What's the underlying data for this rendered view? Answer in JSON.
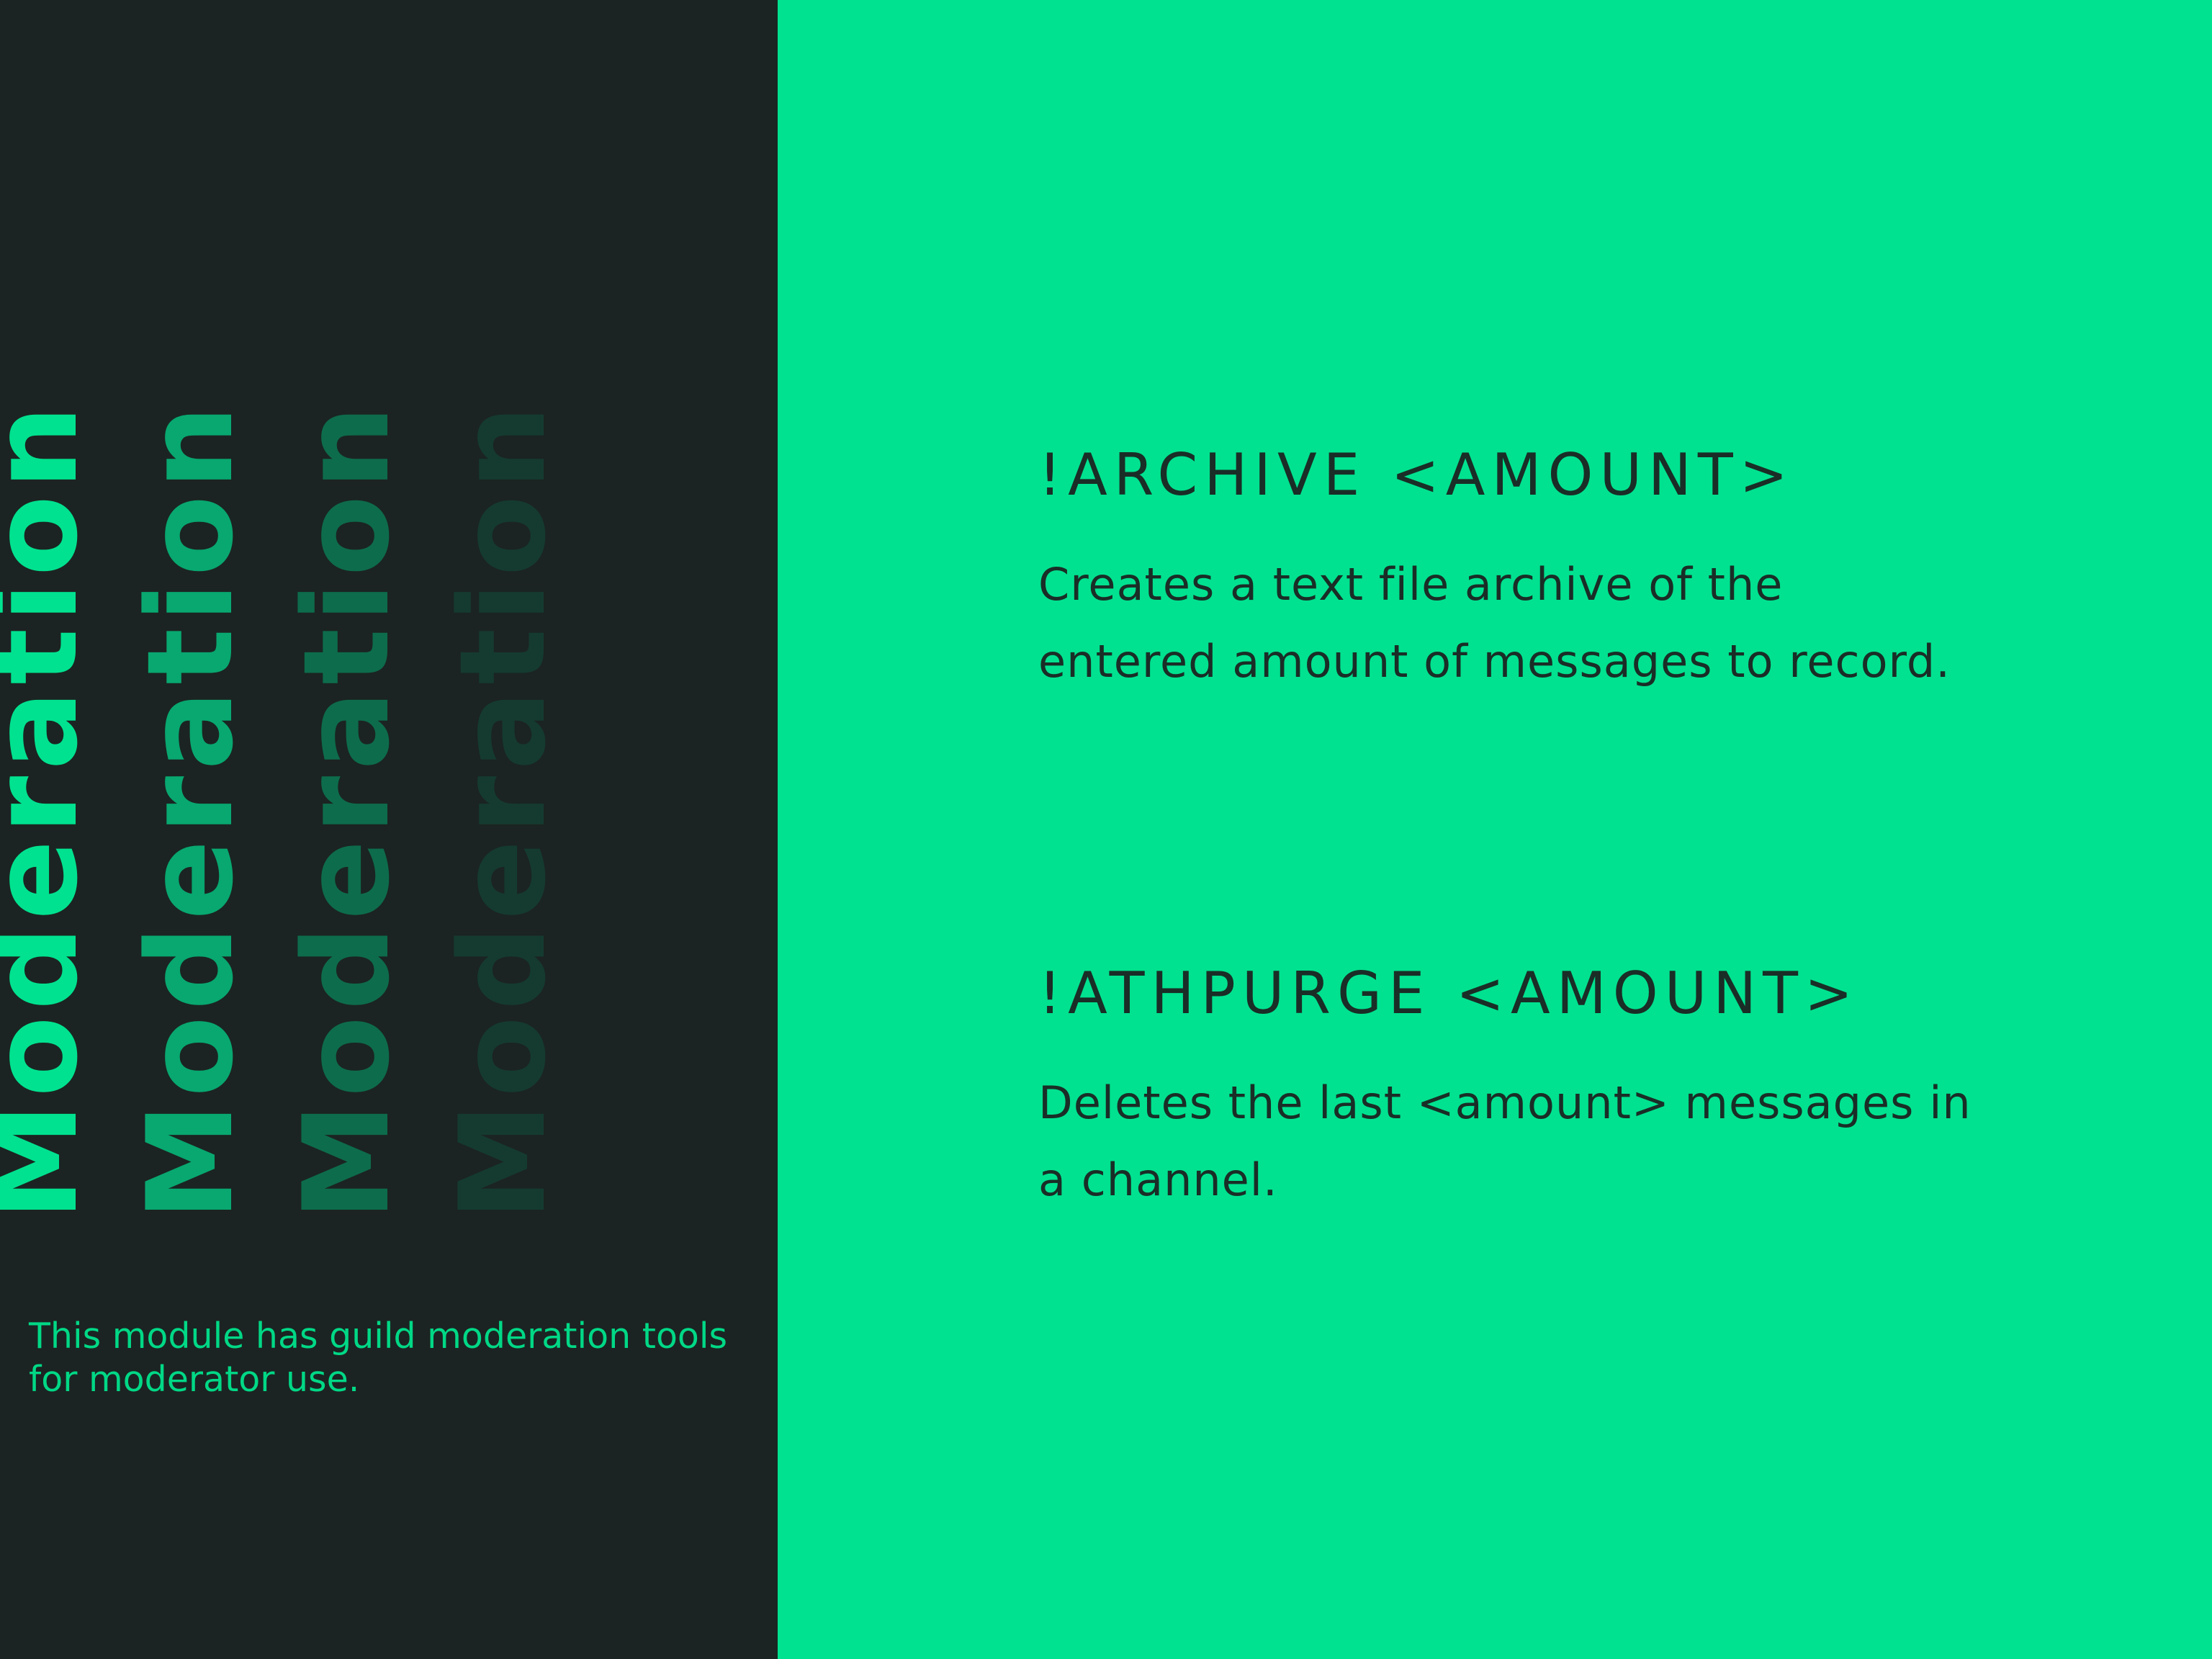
{
  "sidebar": {
    "vertical_words": [
      "Moderation",
      "Moderation",
      "Moderation",
      "Moderation"
    ],
    "description": "This module has guild moderation tools for moderator use."
  },
  "commands": [
    {
      "title": "!ARCHIVE <AMOUNT>",
      "description": "Creates a text file archive of the entered amount of messages to record."
    },
    {
      "title": "!ATHPURGE <AMOUNT>",
      "description": "Deletes the last <amount> messages in a channel."
    }
  ],
  "colors": {
    "dark_background": "#1b2422",
    "accent_green": "#00e28f",
    "text_dark": "#1a2d27"
  }
}
